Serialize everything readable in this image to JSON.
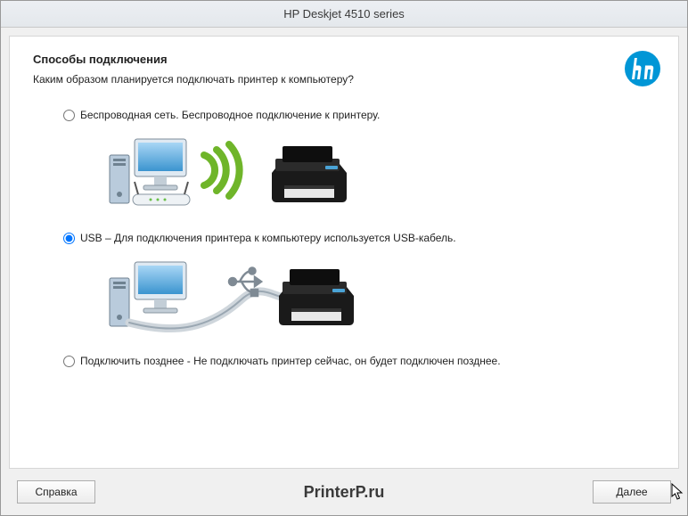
{
  "window": {
    "title": "HP Deskjet 4510 series"
  },
  "page": {
    "heading": "Способы подключения",
    "subheading": "Каким образом планируется подключать принтер к компьютеру?"
  },
  "options": {
    "wireless": {
      "label": "Беспроводная сеть. Беспроводное подключение к принтеру.",
      "selected": false
    },
    "usb": {
      "label": "USB – Для подключения принтера к компьютеру используется USB-кабель.",
      "selected": true
    },
    "later": {
      "label": "Подключить позднее - Не подключать принтер сейчас, он будет подключен  позднее.",
      "selected": false
    }
  },
  "buttons": {
    "help": "Справка",
    "next": "Далее"
  },
  "watermark": "PrinterP.ru",
  "brand": {
    "logo_label": "hp",
    "accent": "#0096D6"
  }
}
